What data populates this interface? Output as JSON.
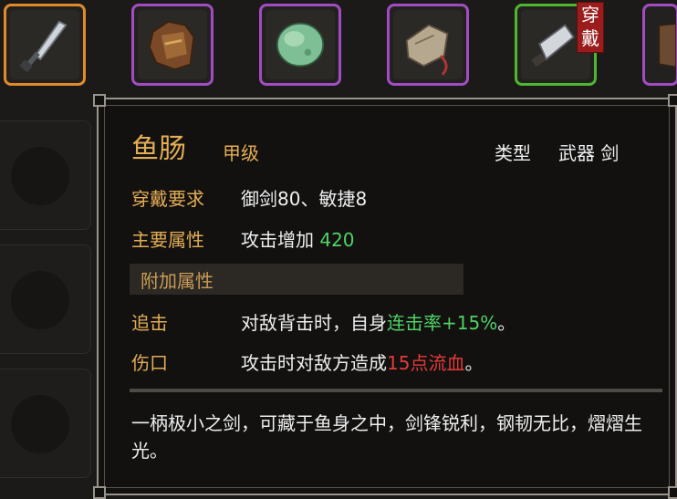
{
  "inventory": {
    "slots": [
      {
        "name": "dagger",
        "rarity": "orange"
      },
      {
        "name": "leather-armor",
        "rarity": "purple"
      },
      {
        "name": "jade-stone",
        "rarity": "purple"
      },
      {
        "name": "stone-amulet",
        "rarity": "purple"
      },
      {
        "name": "cleaver-sword",
        "rarity": "green",
        "equipped": true
      },
      {
        "name": "armor-piece",
        "rarity": "purple"
      }
    ],
    "equipped_tag": "穿戴"
  },
  "tooltip": {
    "item_name": "鱼肠",
    "grade": "甲级",
    "type_label": "类型",
    "type_value": "武器 剑",
    "requirement_label": "穿戴要求",
    "requirement_value": "御剑80、敏捷8",
    "main_attr_label": "主要属性",
    "main_attr_text": "攻击增加",
    "main_attr_value": "420",
    "extra_attr_header": "附加属性",
    "extras": [
      {
        "name": "追击",
        "text_before": "对敌背击时，自身",
        "highlight": "连击率+15%",
        "text_after": "。",
        "highlight_color": "#4fd265"
      },
      {
        "name": "伤口",
        "text_before": "攻击时对敌方造成",
        "highlight": "15点流血",
        "text_after": "。",
        "highlight_color": "#e43a3a"
      }
    ],
    "description": "一柄极小之剑，可藏于鱼身之中，剑锋锐利，钢韧无比，熠熠生光。"
  },
  "colors": {
    "gold": "#e3ad55",
    "orange_rarity": "#e08a2c",
    "purple_rarity": "#a24cc4",
    "green_rarity": "#4fb62f",
    "tag_red": "#9b1c1c"
  }
}
